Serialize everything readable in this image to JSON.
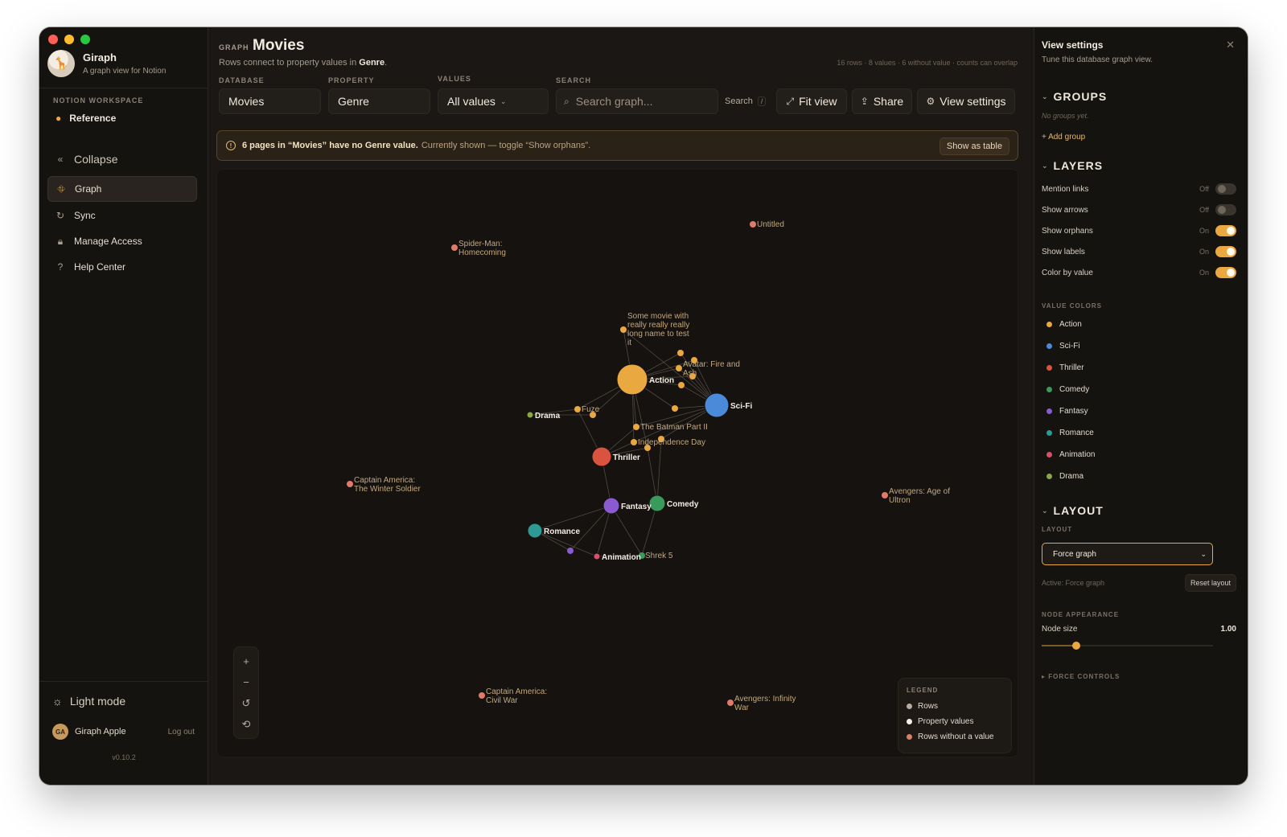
{
  "app": {
    "name": "Giraph",
    "tagline": "A graph view for Notion"
  },
  "sidebar": {
    "workspace_label": "NOTION WORKSPACE",
    "workspace_item": "Reference",
    "collapse_label": "Collapse",
    "items": [
      {
        "label": "Graph",
        "icon": "graph-icon",
        "active": true
      },
      {
        "label": "Sync",
        "icon": "sync-icon"
      },
      {
        "label": "Manage Access",
        "icon": "lock-icon"
      },
      {
        "label": "Help Center",
        "icon": "help-icon"
      }
    ],
    "light_mode_label": "Light mode",
    "user": {
      "initials": "GA",
      "name": "Giraph Apple",
      "logout": "Log out"
    },
    "version": "v0.10.2"
  },
  "header": {
    "kicker": "GRAPH",
    "title": "Movies",
    "subtitle_prefix": "Rows connect to property values in",
    "subtitle_property": "Genre",
    "subtitle_suffix": ".",
    "stats": "16 rows · 8 values · 6 without value · counts can overlap"
  },
  "controls": {
    "database_label": "DATABASE",
    "database_value": "Movies",
    "property_label": "PROPERTY",
    "property_value": "Genre",
    "values_label": "VALUES",
    "values_value": "All values",
    "search_label": "SEARCH",
    "search_placeholder": "Search graph...",
    "search_button": "Search",
    "search_shortcut": "/",
    "fit_view": "Fit view",
    "share": "Share",
    "view_settings": "View settings"
  },
  "banner": {
    "count_text": "6 pages in “Movies” have no Genre value.",
    "detail": "Currently shown — toggle “Show orphans”.",
    "button": "Show as table"
  },
  "graph": {
    "hubs": [
      {
        "label": "Action",
        "color": "#e9a840"
      },
      {
        "label": "Sci-Fi",
        "color": "#4a8ad8"
      },
      {
        "label": "Thriller",
        "color": "#d9533f"
      },
      {
        "label": "Comedy",
        "color": "#3a9a5c"
      },
      {
        "label": "Fantasy",
        "color": "#8a5ad0"
      },
      {
        "label": "Romance",
        "color": "#2e9a96"
      },
      {
        "label": "Animation",
        "color": "#d9506a"
      },
      {
        "label": "Drama",
        "color": "#8aa842"
      }
    ],
    "rows": [
      {
        "label": "Some movie with really really really long name to test it"
      },
      {
        "label": "Avatar: Fire and Ash"
      },
      {
        "label": "Fuze"
      },
      {
        "label": "The Batman Part II"
      },
      {
        "label": "Independence Day"
      },
      {
        "label": "Shrek 5"
      }
    ],
    "orphans": [
      {
        "label": "Untitled"
      },
      {
        "label": "Spider-Man: Homecoming"
      },
      {
        "label": "Captain America: The Winter Soldier"
      },
      {
        "label": "Avengers: Age of Ultron"
      },
      {
        "label": "Captain America: Civil War"
      },
      {
        "label": "Avengers: Infinity War"
      }
    ]
  },
  "legend": {
    "title": "LEGEND",
    "items": [
      {
        "label": "Rows",
        "color": "#b7ad9f"
      },
      {
        "label": "Property values",
        "color": "#f6efe3"
      },
      {
        "label": "Rows without a value",
        "color": "#e07a6a"
      }
    ]
  },
  "panel": {
    "title": "View settings",
    "subtitle": "Tune this database graph view.",
    "groups_title": "GROUPS",
    "no_groups": "No groups yet.",
    "add_group": "+ Add group",
    "layers_title": "LAYERS",
    "layers": [
      {
        "label": "Mention links",
        "state": "Off",
        "on": false
      },
      {
        "label": "Show arrows",
        "state": "Off",
        "on": false
      },
      {
        "label": "Show orphans",
        "state": "On",
        "on": true
      },
      {
        "label": "Show labels",
        "state": "On",
        "on": true
      },
      {
        "label": "Color by value",
        "state": "On",
        "on": true
      }
    ],
    "value_colors_label": "VALUE COLORS",
    "value_colors": [
      {
        "label": "Action",
        "color": "#e9a840"
      },
      {
        "label": "Sci-Fi",
        "color": "#4a8ad8"
      },
      {
        "label": "Thriller",
        "color": "#d9533f"
      },
      {
        "label": "Comedy",
        "color": "#3a9a5c"
      },
      {
        "label": "Fantasy",
        "color": "#8a5ad0"
      },
      {
        "label": "Romance",
        "color": "#2e9a96"
      },
      {
        "label": "Animation",
        "color": "#d9506a"
      },
      {
        "label": "Drama",
        "color": "#8aa842"
      }
    ],
    "layout_title": "LAYOUT",
    "layout_label": "LAYOUT",
    "layout_value": "Force graph",
    "active_note": "Active: Force graph",
    "reset_layout": "Reset layout",
    "node_appearance_label": "NODE APPEARANCE",
    "node_size_label": "Node size",
    "node_size_value": "1.00",
    "node_size_level": 0.2,
    "force_controls": "▸ FORCE CONTROLS"
  }
}
